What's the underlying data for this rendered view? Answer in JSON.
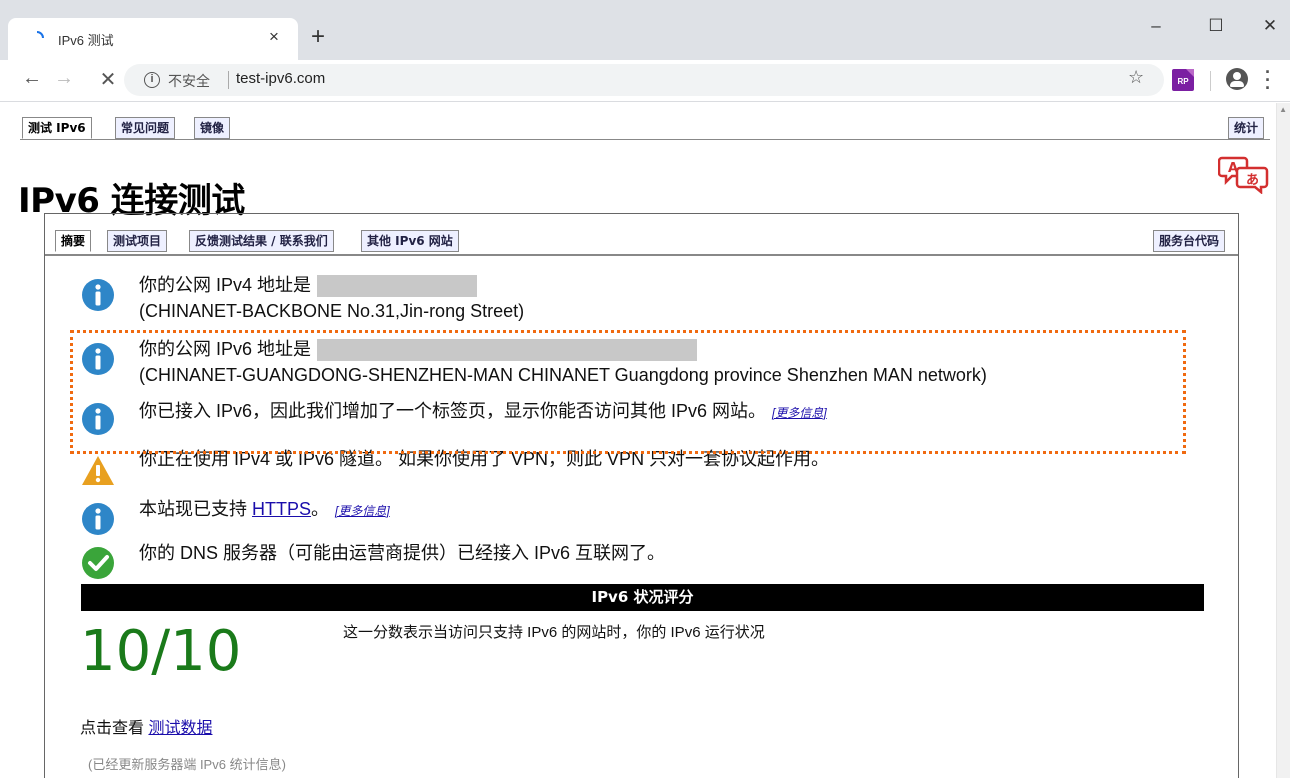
{
  "browser": {
    "tab_title": "IPv6 测试",
    "tab_close": "×",
    "new_tab": "+",
    "window_minimize": "–",
    "window_maximize": "☐",
    "window_close": "✕",
    "back": "←",
    "forward": "→",
    "stop": "✕",
    "security_label": "不安全",
    "url": "test-ipv6.com",
    "bookmark_star": "☆",
    "extension_label": "RP",
    "menu": "⋮"
  },
  "site_nav": {
    "tabs": [
      "测试 IPv6",
      "常见问题",
      "镜像"
    ],
    "stats": "统计"
  },
  "page": {
    "title": "IPv6 连接测试"
  },
  "panel_nav": {
    "tabs": [
      "摘要",
      "测试项目",
      "反馈测试结果 / 联系我们",
      "其他 IPv6 网站"
    ],
    "helpdesk": "服务台代码"
  },
  "messages": {
    "ipv4_line1": "你的公网 IPv4 地址是",
    "ipv4_line2": "(CHINANET-BACKBONE No.31,Jin-rong Street)",
    "ipv6_line1": "你的公网 IPv6 地址是",
    "ipv6_line2": "(CHINANET-GUANGDONG-SHENZHEN-MAN CHINANET Guangdong province Shenzhen MAN network)",
    "ipv6_tab": "你已接入 IPv6，因此我们增加了一个标签页，显示你能否访问其他 IPv6 网站。",
    "more_info": "[更多信息]",
    "tunnel_warning": "你正在使用 IPv4 或 IPv6 隧道。 如果你使用了 VPN，则此 VPN 只对一套协议起作用。",
    "https_prefix": "本站现已支持 ",
    "https_link": "HTTPS",
    "https_suffix": "。",
    "dns_ok": "你的 DNS 服务器（可能由运营商提供）已经接入 IPv6 互联网了。"
  },
  "score": {
    "header": "IPv6 状况评分",
    "value": "10/10",
    "description": "这一分数表示当访问只支持 IPv6 的网站时，你的 IPv6 运行状况",
    "view_prefix": "点击查看 ",
    "view_link": "测试数据",
    "updated_note": "(已经更新服务器端 IPv6 统计信息)"
  },
  "colors": {
    "info_blue": "#2e86c8",
    "warning_orange": "#e8a020",
    "ok_green": "#3aa53a",
    "score_green": "#1a7a1a",
    "highlight_orange": "#f06a10"
  }
}
